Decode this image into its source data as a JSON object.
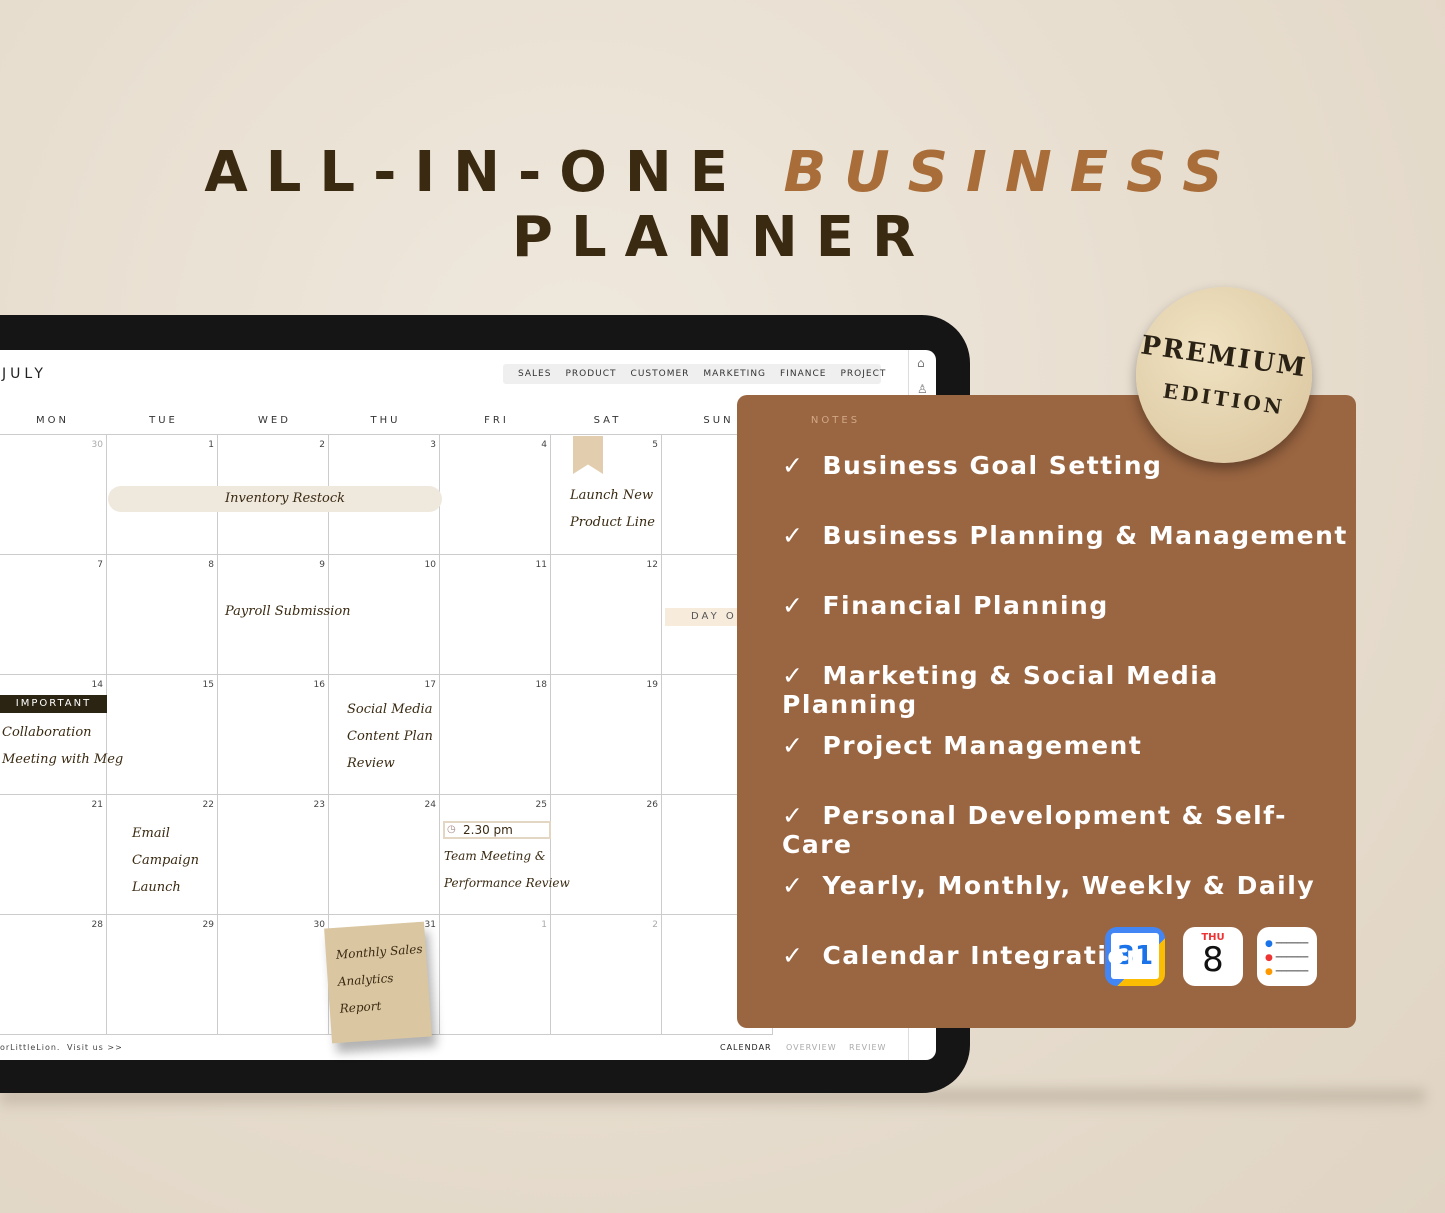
{
  "headline": {
    "part1": "ALL-IN-ONE",
    "accent": "BUSINESS",
    "part2": "PLANNER"
  },
  "planner": {
    "month": "JULY",
    "tabs": [
      "SALES",
      "PRODUCT",
      "CUSTOMER",
      "MARKETING",
      "FINANCE",
      "PROJECT"
    ],
    "weekdays": [
      "MON",
      "TUE",
      "WED",
      "THU",
      "FRI",
      "SAT",
      "SUN"
    ],
    "notes_header": "NOTES",
    "weeks": [
      [
        "30",
        "1",
        "2",
        "3",
        "4",
        "5"
      ],
      [
        "7",
        "8",
        "9",
        "10",
        "11",
        "12"
      ],
      [
        "14",
        "15",
        "16",
        "17",
        "18",
        "19"
      ],
      [
        "21",
        "22",
        "23",
        "24",
        "25",
        "26"
      ],
      [
        "28",
        "29",
        "30",
        "31",
        "1",
        "2"
      ]
    ],
    "events": {
      "inventory": "Inventory Restock",
      "launch1": "Launch New",
      "launch2": "Product Line",
      "payroll": "Payroll Submission",
      "dayoff": "DAY O",
      "important": "IMPORTANT",
      "collab1": "Collaboration",
      "collab2": "Meeting with Meg",
      "social1": "Social Media",
      "social2": "Content Plan",
      "social3": "Review",
      "email1": "Email",
      "email2": "Campaign",
      "email3": "Launch",
      "time": "2.30 pm",
      "team1": "Team Meeting &",
      "team2": "Performance Review",
      "sales1": "Monthly Sales",
      "sales2": "Analytics",
      "sales3": "Report"
    },
    "footer": {
      "left": "orLittleLion.",
      "visit": "Visit us >>",
      "nav": [
        "CALENDAR",
        "OVERVIEW",
        "REVIEW"
      ]
    },
    "side_icons": [
      "home-icon",
      "user-icon"
    ]
  },
  "features": [
    "Business Goal Setting",
    "Business Planning & Management",
    "Financial Planning",
    "Marketing & Social Media Planning",
    "Project Management",
    "Personal Development & Self-Care",
    "Yearly, Monthly, Weekly & Daily",
    "Calendar Integration"
  ],
  "badge": {
    "line1": "PREMIUM",
    "line2": "EDITION"
  },
  "apps": {
    "gcal": "31",
    "ical_day": "THU",
    "ical_date": "8"
  },
  "colors": {
    "panel": "#9a6541",
    "accent": "#a86d38",
    "dark": "#3a2a12"
  }
}
